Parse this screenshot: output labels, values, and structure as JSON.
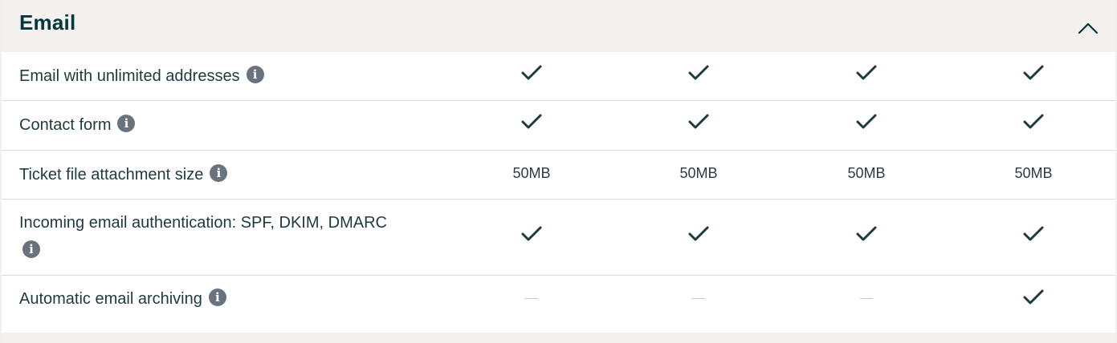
{
  "section": {
    "title": "Email",
    "toggle_icon": "chevron-up-icon"
  },
  "columns": [
    "plan-1",
    "plan-2",
    "plan-3",
    "plan-4"
  ],
  "rows": [
    {
      "feature": "Email with unlimited addresses",
      "values": [
        "check",
        "check",
        "check",
        "check"
      ]
    },
    {
      "feature": "Contact form",
      "values": [
        "check",
        "check",
        "check",
        "check"
      ]
    },
    {
      "feature": "Ticket file attachment size",
      "values": [
        "50MB",
        "50MB",
        "50MB",
        "50MB"
      ]
    },
    {
      "feature": "Incoming email authentication: SPF, DKIM, DMARC",
      "values": [
        "check",
        "check",
        "check",
        "check"
      ]
    },
    {
      "feature": "Automatic email archiving",
      "values": [
        "dash",
        "dash",
        "dash",
        "check"
      ]
    }
  ],
  "colors": {
    "header_bg": "#f3f0ed",
    "title": "#03363d",
    "check": "#1f3a3d",
    "info_icon_bg": "#68737d",
    "divider": "#d8dcde"
  }
}
